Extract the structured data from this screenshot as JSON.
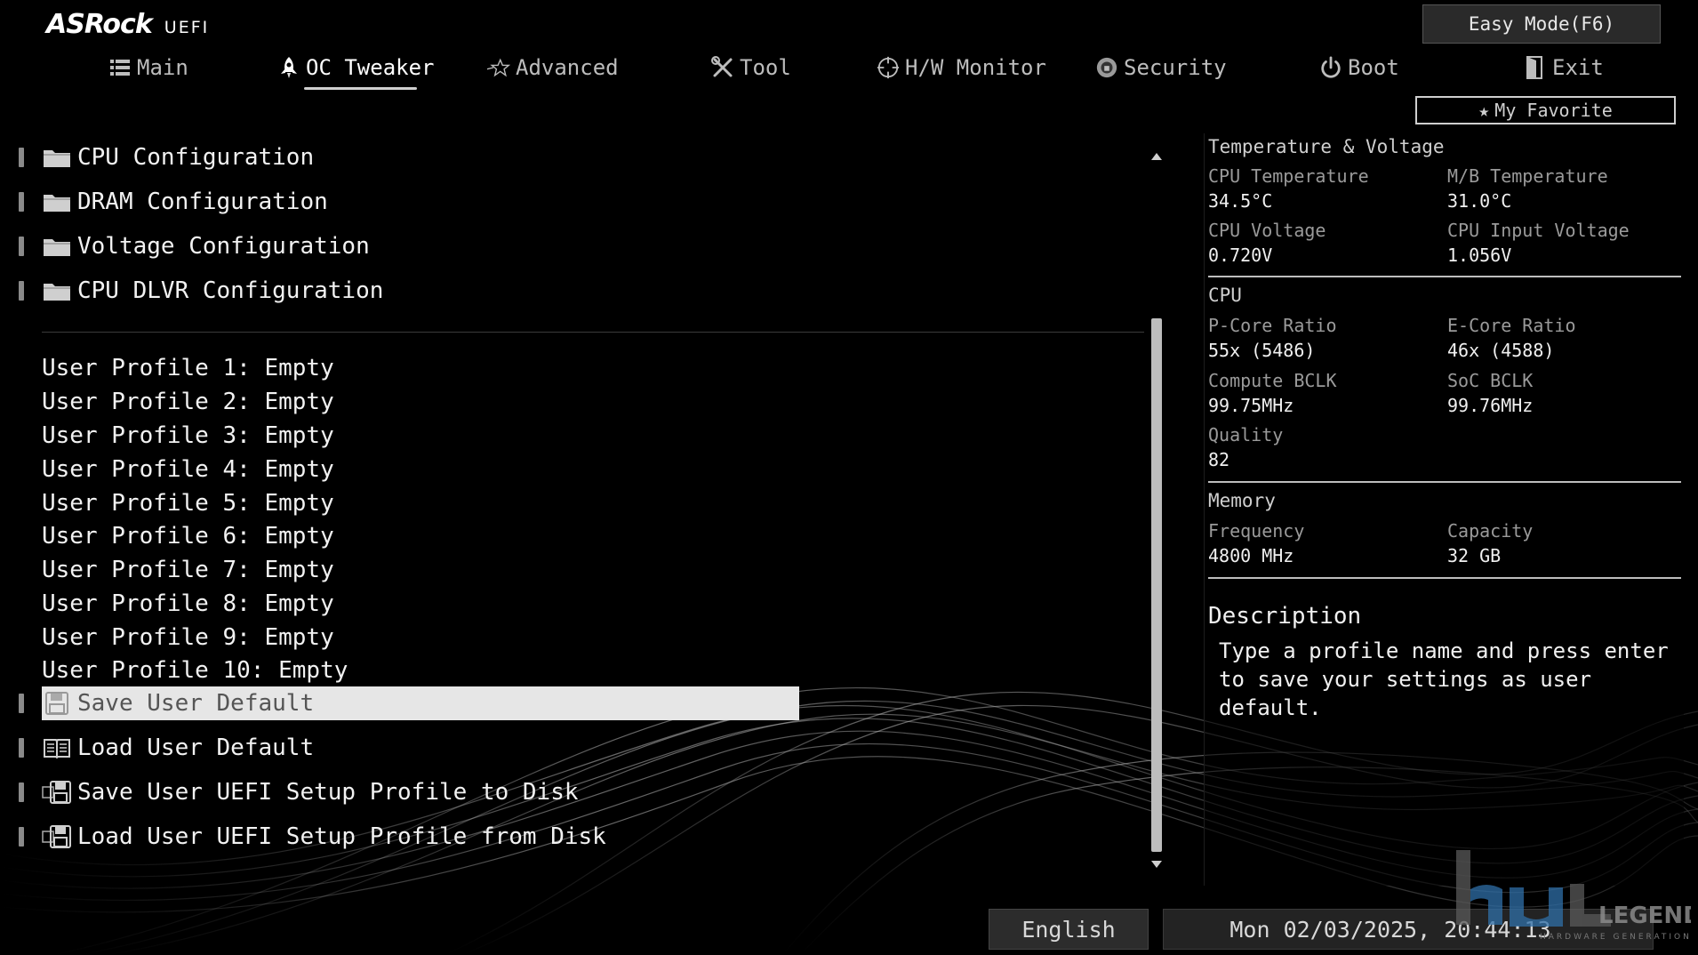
{
  "header": {
    "brand": "ASRock",
    "product": "UEFI",
    "easy_mode_label": "Easy Mode(F6)",
    "my_favorite_label": "My Favorite"
  },
  "tabs": [
    {
      "label": "Main",
      "icon": "list-icon",
      "active": false
    },
    {
      "label": "OC Tweaker",
      "icon": "rocket-icon",
      "active": true
    },
    {
      "label": "Advanced",
      "icon": "star-icon",
      "active": false
    },
    {
      "label": "Tool",
      "icon": "tools-icon",
      "active": false
    },
    {
      "label": "H/W Monitor",
      "icon": "monitor-target-icon",
      "active": false
    },
    {
      "label": "Security",
      "icon": "shield-icon",
      "active": false
    },
    {
      "label": "Boot",
      "icon": "power-icon",
      "active": false
    },
    {
      "label": "Exit",
      "icon": "exit-icon",
      "active": false
    }
  ],
  "submenus": [
    {
      "label": "CPU Configuration",
      "icon": "folder-icon"
    },
    {
      "label": "DRAM Configuration",
      "icon": "folder-icon"
    },
    {
      "label": "Voltage Configuration",
      "icon": "folder-icon"
    },
    {
      "label": "CPU DLVR Configuration",
      "icon": "folder-icon"
    }
  ],
  "profiles": [
    "User Profile 1: Empty",
    "User Profile 2: Empty",
    "User Profile 3: Empty",
    "User Profile 4: Empty",
    "User Profile 5: Empty",
    "User Profile 6: Empty",
    "User Profile 7: Empty",
    "User Profile 8: Empty",
    "User Profile 9: Empty",
    "User Profile 10: Empty"
  ],
  "actions": [
    {
      "label": "Save User Default",
      "icon": "floppy-icon",
      "selected": true
    },
    {
      "label": "Load User Default",
      "icon": "book-icon",
      "selected": false
    },
    {
      "label": "Save User UEFI Setup Profile to Disk",
      "icon": "disk-save-icon",
      "selected": false
    },
    {
      "label": "Load User UEFI Setup Profile from Disk",
      "icon": "disk-load-icon",
      "selected": false
    }
  ],
  "info": {
    "temp_voltage": {
      "title": "Temperature & Voltage",
      "cpu_temp_label": "CPU Temperature",
      "cpu_temp": "34.5°C",
      "mb_temp_label": "M/B Temperature",
      "mb_temp": "31.0°C",
      "cpu_voltage_label": "CPU Voltage",
      "cpu_voltage": "0.720V",
      "cpu_input_voltage_label": "CPU Input Voltage",
      "cpu_input_voltage": "1.056V"
    },
    "cpu": {
      "title": "CPU",
      "pcore_label": "P-Core Ratio",
      "pcore": "55x (5486)",
      "ecore_label": "E-Core Ratio",
      "ecore": "46x (4588)",
      "compute_bclk_label": "Compute BCLK",
      "compute_bclk": "99.75MHz",
      "soc_bclk_label": "SoC BCLK",
      "soc_bclk": "99.76MHz",
      "quality_label": "Quality",
      "quality": "82"
    },
    "memory": {
      "title": "Memory",
      "frequency_label": "Frequency",
      "frequency": "4800 MHz",
      "capacity_label": "Capacity",
      "capacity": "32 GB"
    },
    "description": {
      "title": "Description",
      "text": "Type a profile name and press enter to save your settings as user default."
    }
  },
  "status": {
    "language": "English",
    "datetime": "Mon 02/03/2025, 20:44:13"
  },
  "watermark": {
    "text": "LEGEND",
    "subtext": "HARDWARE GENERATION"
  }
}
